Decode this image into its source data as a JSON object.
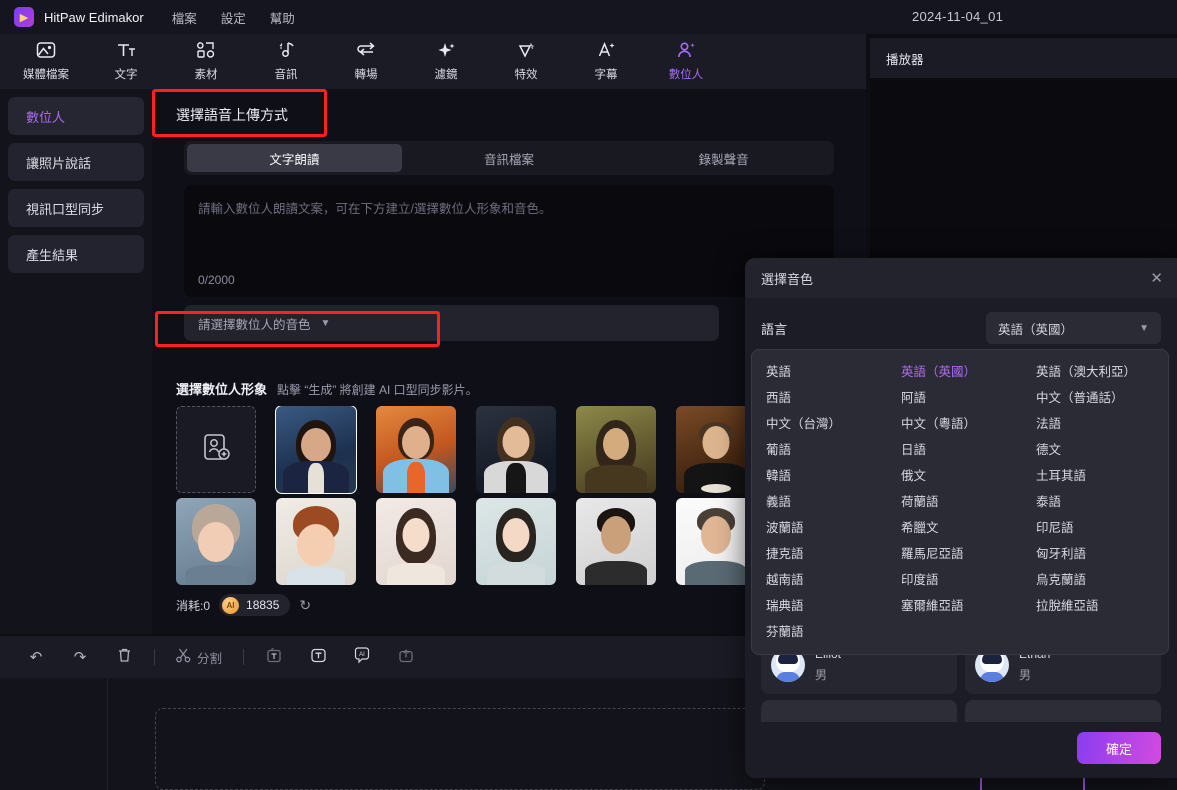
{
  "titlebar": {
    "app_name": "HitPaw Edimakor",
    "menus": [
      "檔案",
      "設定",
      "幫助"
    ],
    "project_name": "2024-11-04_01",
    "logo_icon": "hitpaw-logo-icon"
  },
  "ribbon": {
    "tools": [
      {
        "label": "媒體檔案",
        "icon": "media-file-icon",
        "glyph": "⎙",
        "active": false
      },
      {
        "label": "文字",
        "icon": "text-icon",
        "glyph": "Tт",
        "active": false
      },
      {
        "label": "素材",
        "icon": "stock-assets-icon",
        "glyph": "⚇",
        "active": false
      },
      {
        "label": "音訊",
        "icon": "audio-icon",
        "glyph": "♪",
        "active": false
      },
      {
        "label": "轉場",
        "icon": "transition-icon",
        "glyph": "↩",
        "active": false
      },
      {
        "label": "濾鏡",
        "icon": "filter-sparkle-icon",
        "glyph": "✦",
        "active": false
      },
      {
        "label": "特效",
        "icon": "effects-icon",
        "glyph": "◁",
        "active": false
      },
      {
        "label": "字幕",
        "icon": "subtitle-icon",
        "glyph": "A",
        "active": false
      },
      {
        "label": "數位人",
        "icon": "digital-human-icon",
        "glyph": "⛉",
        "active": true
      }
    ]
  },
  "leftnav": {
    "items": [
      {
        "label": "數位人",
        "active": true
      },
      {
        "label": "讓照片說話",
        "active": false
      },
      {
        "label": "視訊口型同步",
        "active": false
      },
      {
        "label": "產生結果",
        "active": false
      }
    ]
  },
  "center": {
    "panel_title": "選擇語音上傳方式",
    "tabs": [
      {
        "label": "文字朗讀",
        "active": true
      },
      {
        "label": "音訊檔案",
        "active": false
      },
      {
        "label": "錄製聲音",
        "active": false
      }
    ],
    "textarea": {
      "placeholder": "請輸入數位人朗讀文案，可在下方建立/選擇數位人形象和音色。",
      "value": "",
      "counter": "0/2000"
    },
    "voice_orb_icon": "voice-preview-orb-icon",
    "tooltips": {
      "select_voice": "選擇音色",
      "language": "語言"
    },
    "voice_select": {
      "placeholder": "請選擇數位人的音色",
      "chevron_icon": "chevron-down-icon"
    },
    "gallery": {
      "title": "選擇數位人形象",
      "subtitle": "點擊 “生成” 將創建 AI 口型同步影片。",
      "add_icon": "add-avatar-icon",
      "avatars": [
        {
          "name": "add-new",
          "type": "add"
        },
        {
          "name": "businesswoman-navy",
          "selected": true
        },
        {
          "name": "woman-blue-blazer",
          "selected": false
        },
        {
          "name": "woman-white-jacket",
          "selected": false
        },
        {
          "name": "mona-lisa",
          "selected": false
        },
        {
          "name": "shakespeare",
          "selected": false
        },
        {
          "name": "girl-with-pearl-earring",
          "selected": false
        },
        {
          "name": "cut-off-avatar",
          "selected": false
        },
        {
          "name": "cartoon-girl-glasses",
          "selected": false
        },
        {
          "name": "cartoon-boy",
          "selected": false
        },
        {
          "name": "asian-woman-1",
          "selected": false
        },
        {
          "name": "asian-woman-2",
          "selected": false
        },
        {
          "name": "man-glasses-dark",
          "selected": false
        },
        {
          "name": "man-glasses-grey",
          "selected": false
        },
        {
          "name": "cut-off-avatar-2",
          "selected": false
        },
        {
          "name": "cut-off-avatar-3",
          "selected": false
        }
      ]
    },
    "credits": {
      "label": "消耗:0",
      "coin_icon": "ai-coin-icon",
      "coin_text": "AI",
      "amount": "18835",
      "refresh_icon": "refresh-icon"
    }
  },
  "player": {
    "title": "播放器"
  },
  "bottom_toolbar": {
    "buttons": [
      {
        "name": "undo-button",
        "icon": "undo-icon",
        "glyph": "↶"
      },
      {
        "name": "redo-button",
        "icon": "redo-icon",
        "glyph": "↷"
      },
      {
        "name": "delete-button",
        "icon": "trash-icon",
        "glyph": "🗑"
      }
    ],
    "split_label": "分割",
    "split_icon": "scissors-icon",
    "right_buttons": [
      {
        "name": "crop-button",
        "icon": "crop-text-icon",
        "glyph": "⊡"
      },
      {
        "name": "text-button",
        "icon": "text-box-icon",
        "glyph": "T"
      },
      {
        "name": "ai-button",
        "icon": "ai-bubble-icon",
        "glyph": "AI"
      },
      {
        "name": "export-clip-button",
        "icon": "export-box-icon",
        "glyph": "⤒"
      }
    ]
  },
  "modal": {
    "title": "選擇音色",
    "close_icon": "close-icon",
    "language_label": "語言",
    "language_value": "英語（英國）",
    "chevron_icon": "chevron-down-icon",
    "languages": [
      {
        "label": "英語",
        "active": false
      },
      {
        "label": "英語（英國）",
        "active": true
      },
      {
        "label": "英語（澳大利亞）",
        "active": false
      },
      {
        "label": "西語",
        "active": false
      },
      {
        "label": "阿語",
        "active": false
      },
      {
        "label": "中文（普通話）",
        "active": false
      },
      {
        "label": "中文（台灣）",
        "active": false
      },
      {
        "label": "中文（粵語）",
        "active": false
      },
      {
        "label": "法語",
        "active": false
      },
      {
        "label": "葡語",
        "active": false
      },
      {
        "label": "日語",
        "active": false
      },
      {
        "label": "德文",
        "active": false
      },
      {
        "label": "韓語",
        "active": false
      },
      {
        "label": "俄文",
        "active": false
      },
      {
        "label": "土耳其語",
        "active": false
      },
      {
        "label": "義語",
        "active": false
      },
      {
        "label": "荷蘭語",
        "active": false
      },
      {
        "label": "泰語",
        "active": false
      },
      {
        "label": "波蘭語",
        "active": false
      },
      {
        "label": "希臘文",
        "active": false
      },
      {
        "label": "印尼語",
        "active": false
      },
      {
        "label": "捷克語",
        "active": false
      },
      {
        "label": "羅馬尼亞語",
        "active": false
      },
      {
        "label": "匈牙利語",
        "active": false
      },
      {
        "label": "越南語",
        "active": false
      },
      {
        "label": "印度語",
        "active": false
      },
      {
        "label": "烏克蘭語",
        "active": false
      },
      {
        "label": "瑞典語",
        "active": false
      },
      {
        "label": "塞爾維亞語",
        "active": false
      },
      {
        "label": "拉脫維亞語",
        "active": false
      },
      {
        "label": "芬蘭語",
        "active": false
      }
    ],
    "voices": [
      {
        "name": "Elliot",
        "gender": "男",
        "avatar_icon": "voice-avatar-icon"
      },
      {
        "name": "Ethan",
        "gender": "男",
        "avatar_icon": "voice-avatar-icon"
      }
    ],
    "confirm_label": "確定"
  },
  "colors": {
    "accent": "#a86bf0",
    "accent_gradient_start": "#8a3df0",
    "accent_gradient_end": "#d34ae0",
    "highlight_box": "#ff2020",
    "window_bg": "#0d0d14",
    "panel_bg": "#1b1b26"
  }
}
